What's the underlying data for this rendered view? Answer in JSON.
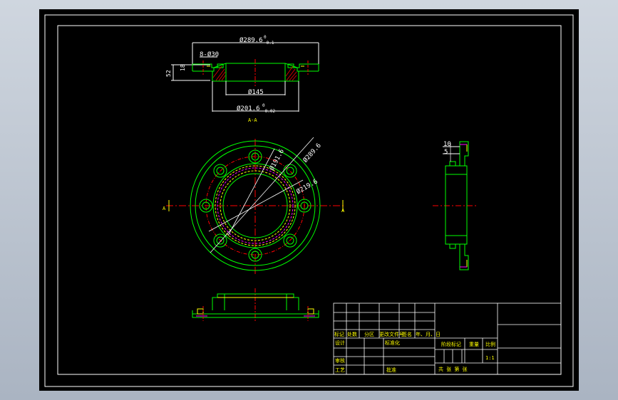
{
  "colors": {
    "background": "#000000",
    "outline": "#ffffff",
    "part": "#00ff00",
    "center_line": "#ff0000",
    "hidden_line": "#ffff00",
    "accent": "#ff00ff"
  },
  "top_view": {
    "dim_top": "Ø289.6",
    "dim_top_tol_upper": "0",
    "dim_top_tol_lower": "-0.1",
    "dim_holes": "8-Ø30",
    "dim_height": "52",
    "dim_flange": "18",
    "dim_bore": "Ø145",
    "dim_bottom": "Ø201.6",
    "dim_bottom_tol_upper": "0",
    "dim_bottom_tol_lower": "-0.02",
    "section_label": "A-A"
  },
  "front_view": {
    "dim_a": "Ø191.6",
    "dim_b": "Ø289.6",
    "dim_c": "Ø219.6",
    "section_mark_left": "A",
    "section_mark_right": "A"
  },
  "side_view": {
    "dim_10": "10",
    "dim_5": "5"
  },
  "title_block": {
    "row_labels": [
      "标记",
      "处数",
      "分区",
      "更改文件号",
      "签名",
      "年、月、日"
    ],
    "design": "设计",
    "standardization": "标准化",
    "review": "审核",
    "process": "工艺",
    "approve": "批准",
    "stage_mark": "阶段标记",
    "weight": "重量",
    "scale": "比例",
    "scale_value": "1:1",
    "sheets": "共  张  第  张"
  }
}
